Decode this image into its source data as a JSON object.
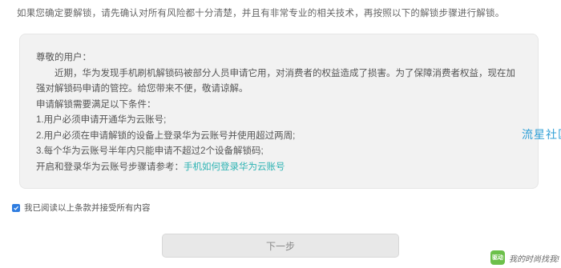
{
  "intro": "如果您确定要解锁，请先确认对所有风险都十分清楚，并且有非常专业的相关技术，再按照以下的解锁步骤进行解锁。",
  "notice": {
    "greeting": "尊敬的用户：",
    "body": "近期，华为发现手机刷机解锁码被部分人员申请它用，对消费者的权益造成了损害。为了保障消费者权益，现在加强对解锁码申请的管控。给您带来不便，敬请谅解。",
    "conditions_title": "申请解锁需要满足以下条件：",
    "conditions": [
      "1.用户必须申请开通华为云账号;",
      "2.用户必须在申请解锁的设备上登录华为云账号并使用超过两周;",
      "3.每个华为云账号半年内只能申请不超过2个设备解锁码;"
    ],
    "reference_prefix": "开启和登录华为云账号步骤请参考：",
    "reference_link": "手机如何登录华为云账号"
  },
  "watermark_side": "流星社区",
  "agreement": {
    "label": "我已阅读以上条款并接受所有内容",
    "checked": true,
    "accent_color": "#2f7de0"
  },
  "next_button": {
    "label": "下一步"
  },
  "watermark_bottom": {
    "logo": "驱动",
    "text": "我的时尚找我!"
  }
}
